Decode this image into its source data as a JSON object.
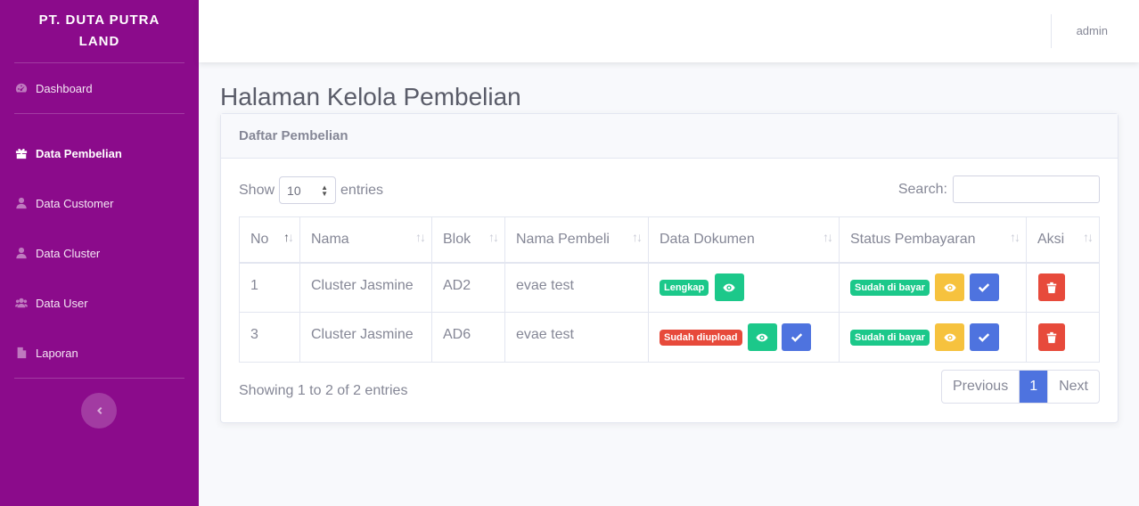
{
  "sidebar": {
    "brand": "PT. DUTA PUTRA LAND",
    "items": [
      {
        "label": "Dashboard",
        "icon": "tachometer-icon"
      },
      {
        "label": "Data Pembelian",
        "icon": "gift-icon"
      },
      {
        "label": "Data Customer",
        "icon": "user-icon"
      },
      {
        "label": "Data Cluster",
        "icon": "user-icon"
      },
      {
        "label": "Data User",
        "icon": "users-icon"
      },
      {
        "label": "Laporan",
        "icon": "file-icon"
      }
    ],
    "active": "Data Pembelian"
  },
  "topbar": {
    "user": "admin"
  },
  "page": {
    "title": "Halaman Kelola Pembelian"
  },
  "card": {
    "header": "Daftar Pembelian"
  },
  "controls": {
    "show_label": "Show",
    "entries_value": "10",
    "entries_label": "entries",
    "search_label": "Search:"
  },
  "table": {
    "headers": [
      "No",
      "Nama",
      "Blok",
      "Nama Pembeli",
      "Data Dokumen",
      "Status Pembayaran",
      "Aksi"
    ],
    "rows": [
      {
        "no": "1",
        "nama": "Cluster Jasmine",
        "blok": "AD2",
        "pembeli": "evae test",
        "dokumen": "Lengkap",
        "status": "Sudah di bayar"
      },
      {
        "no": "3",
        "nama": "Cluster Jasmine",
        "blok": "AD6",
        "pembeli": "evae test",
        "dokumen": "Sudah diupload",
        "status": "Sudah di bayar"
      }
    ]
  },
  "footer": {
    "info": "Showing 1 to 2 of 2 entries",
    "prev": "Previous",
    "page": "1",
    "next": "Next"
  },
  "colors": {
    "sidebar": "#8b0b8b",
    "primary": "#4e73df",
    "success": "#1cc88a",
    "warning": "#f6c23e",
    "danger": "#e74a3b"
  }
}
